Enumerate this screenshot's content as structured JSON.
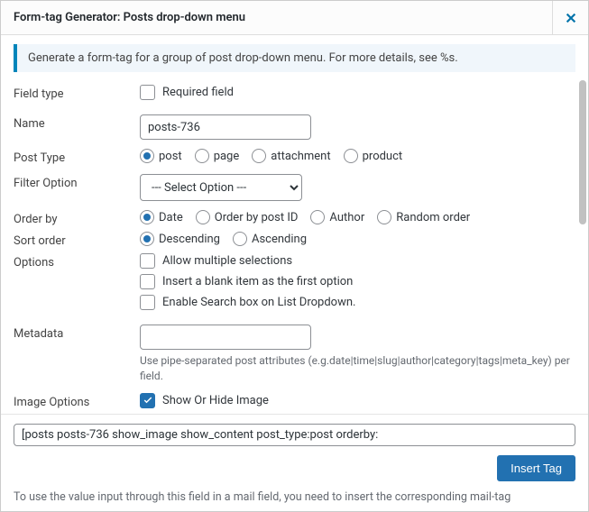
{
  "header": {
    "title": "Form-tag Generator: Posts drop-down menu"
  },
  "notice": "Generate a form-tag for a group of post drop-down menu. For more details, see %s.",
  "labels": {
    "field_type": "Field type",
    "name": "Name",
    "post_type": "Post Type",
    "filter_option": "Filter Option",
    "order_by": "Order by",
    "sort_order": "Sort order",
    "options": "Options",
    "metadata": "Metadata",
    "image_options": "Image Options"
  },
  "field_type": {
    "required_label": "Required field"
  },
  "name": {
    "value": "posts-736"
  },
  "post_type": {
    "options": [
      "post",
      "page",
      "attachment",
      "product"
    ],
    "selected": "post"
  },
  "filter_option": {
    "placeholder": "--- Select Option ---"
  },
  "order_by": {
    "options": [
      "Date",
      "Order by post ID",
      "Author",
      "Random order"
    ],
    "selected": "Date"
  },
  "sort_order": {
    "options": [
      "Descending",
      "Ascending"
    ],
    "selected": "Descending"
  },
  "options": {
    "multiple": "Allow multiple selections",
    "blank": "Insert a blank item as the first option",
    "search": "Enable Search box on List Dropdown."
  },
  "metadata": {
    "value": "",
    "hint": "Use pipe-separated post attributes (e.g.date|time|slug|author|category|tags|meta_key) per field."
  },
  "image_options": {
    "show_label": "Show Or Hide Image",
    "show_checked": true
  },
  "tag": "[posts posts-736 show_image show_content post_type:post orderby:",
  "insert_label": "Insert Tag",
  "footnote": "To use the value input through this field in a mail field, you need to insert the corresponding mail-tag"
}
